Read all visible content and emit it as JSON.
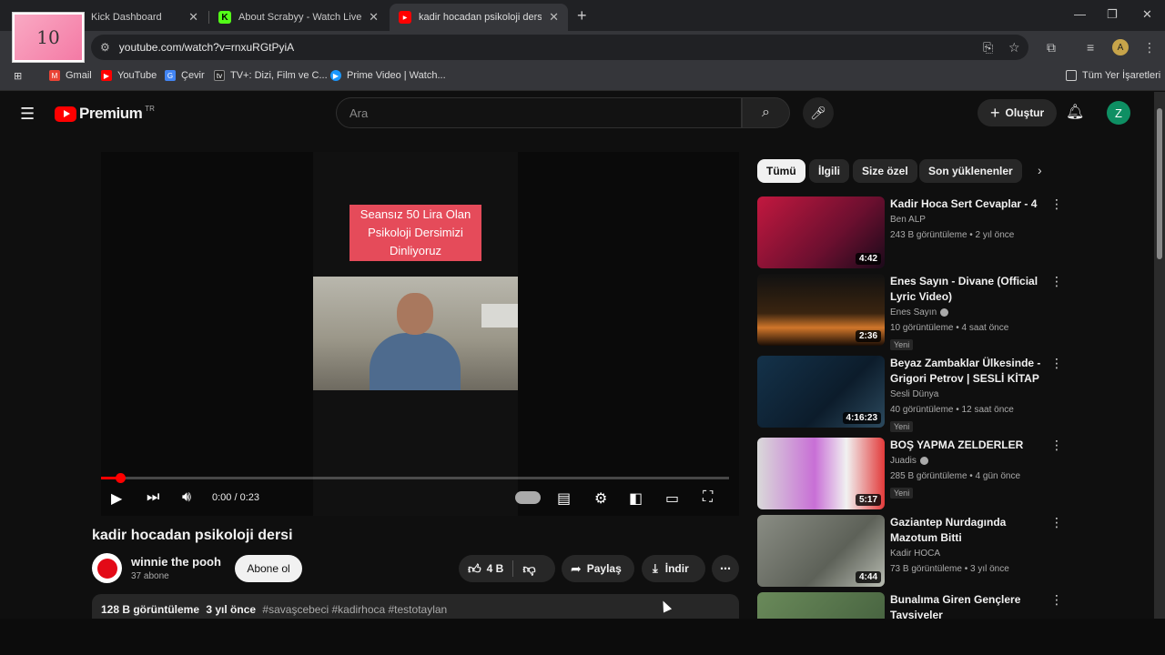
{
  "browser": {
    "tabs": [
      {
        "label": "Kick Dashboard",
        "icon_color": "#53fc18",
        "icon_letter": "K"
      },
      {
        "label": "About Scrabyy - Watch Live on",
        "icon_color": "#53fc18",
        "icon_letter": "K"
      },
      {
        "label": "kadir hocadan psikoloji dersi - Y",
        "icon_color": "#ff0000",
        "icon_letter": "▶"
      }
    ],
    "url": "youtube.com/watch?v=rnxuRGtPyiA",
    "bookmarks": [
      {
        "label": "Gmail"
      },
      {
        "label": "YouTube"
      },
      {
        "label": "Çevir"
      },
      {
        "label": "TV+: Dizi, Film ve C..."
      },
      {
        "label": "Prime Video | Watch..."
      }
    ],
    "all_bookmarks": "Tüm Yer İşaretleri",
    "profile_letter": "A"
  },
  "overlay": {
    "counter": "10"
  },
  "youtube": {
    "logo": "Premium",
    "country": "TR",
    "search_placeholder": "Ara",
    "create_label": "Oluştur",
    "avatar_letter": "Z",
    "video": {
      "overlay_text": "Seansız 50 Lira Olan Psikoloji Dersimizi Dinliyoruz",
      "time": "0:00 / 0:23",
      "progress": 0.03,
      "title": "kadir hocadan psikoloji dersi",
      "channel": "winnie the pooh",
      "subs": "37 abone",
      "subscribe": "Abone ol",
      "likes": "4 B",
      "share": "Paylaş",
      "download": "İndir",
      "views": "128 B görüntüleme",
      "age": "3 yıl önce",
      "tags": "#savaşcebeci #kadirhoca #testotaylan"
    },
    "chips": [
      "Tümü",
      "İlgili",
      "Size özel",
      "Son yüklenenler"
    ],
    "recs": [
      {
        "title": "Kadir Hoca Sert Cevaplar - 4",
        "channel": "Ben ALP",
        "meta": "243 B görüntüleme • 2 yıl önce",
        "duration": "4:42",
        "new": "",
        "verified": false,
        "thumb": "linear-gradient(135deg,#c2183f,#6b0f2f 60%,#1a0a1a)"
      },
      {
        "title": "Enes Sayın - Divane (Official Lyric Video)",
        "channel": "Enes Sayın",
        "meta": "10 görüntüleme • 4 saat önce",
        "duration": "2:36",
        "new": "Yeni",
        "verified": true,
        "thumb": "linear-gradient(180deg,#111 0%,#3a2410 55%,#d0762a 75%,#1a0d05 100%)"
      },
      {
        "title": "Beyaz Zambaklar Ülkesinde - Grigori Petrov | SESLİ KİTAP | ...",
        "channel": "Sesli Dünya",
        "meta": "40 görüntüleme • 12 saat önce",
        "duration": "4:16:23",
        "new": "Yeni",
        "verified": false,
        "thumb": "linear-gradient(135deg,#14324a,#0c1c2b 60%,#2c4a5e)"
      },
      {
        "title": "BOŞ YAPMA ZELDERLER",
        "channel": "Juadis",
        "meta": "285 B görüntüleme • 4 gün önce",
        "duration": "5:17",
        "new": "Yeni",
        "verified": true,
        "thumb": "linear-gradient(90deg,#d9d9d9 0%,#c86fd6 45%,#f1f1f1 70%,#e23a3a 100%)"
      },
      {
        "title": "Gaziantep Nurdagında Mazotum Bitti",
        "channel": "Kadir HOCA",
        "meta": "73 B görüntüleme • 3 yıl önce",
        "duration": "4:44",
        "new": "",
        "verified": false,
        "thumb": "linear-gradient(135deg,#8a8d84,#5d6158 60%,#b8bcb2)"
      },
      {
        "title": "Bunalıma Giren Gençlere Tavsiyeler",
        "channel": "",
        "meta": "",
        "duration": "",
        "new": "",
        "verified": false,
        "thumb": "linear-gradient(135deg,#6a8a5a,#3f5a3a)"
      }
    ]
  }
}
